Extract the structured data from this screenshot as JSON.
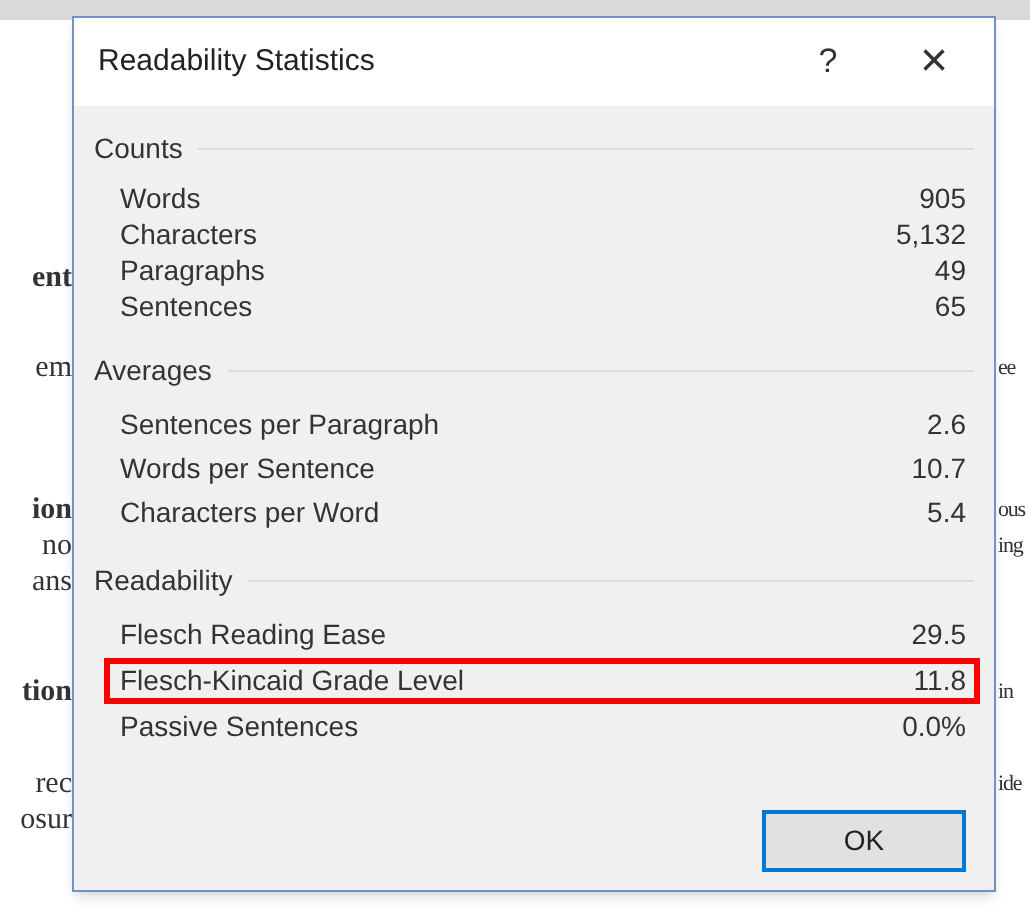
{
  "document": {
    "left_fragments": [
      {
        "text": "ent",
        "bold": true
      },
      {
        "text": "em",
        "bold": false
      },
      {
        "text": "ion",
        "bold": true
      },
      {
        "text": "no",
        "bold": false
      },
      {
        "text": "ans",
        "bold": false
      },
      {
        "text": "tion",
        "bold": true
      },
      {
        "text": "rec",
        "bold": false
      },
      {
        "text": "osur",
        "bold": false
      }
    ],
    "right_fragments": [
      {
        "text": "ee",
        "bold": false
      },
      {
        "text": "ous",
        "bold": false
      },
      {
        "text": "ing",
        "bold": false
      },
      {
        "text": "in",
        "bold": false
      },
      {
        "text": "ide",
        "bold": false
      }
    ]
  },
  "dialog": {
    "title": "Readability Statistics",
    "help": "?",
    "close": "×",
    "sections": [
      {
        "heading": "Counts",
        "rows": [
          {
            "label": "Words",
            "value": "905",
            "highlighted": false
          },
          {
            "label": "Characters",
            "value": "5,132",
            "highlighted": false
          },
          {
            "label": "Paragraphs",
            "value": "49",
            "highlighted": false
          },
          {
            "label": "Sentences",
            "value": "65",
            "highlighted": false
          }
        ]
      },
      {
        "heading": "Averages",
        "rows": [
          {
            "label": "Sentences per Paragraph",
            "value": "2.6",
            "highlighted": false
          },
          {
            "label": "Words per Sentence",
            "value": "10.7",
            "highlighted": false
          },
          {
            "label": "Characters per Word",
            "value": "5.4",
            "highlighted": false
          }
        ]
      },
      {
        "heading": "Readability",
        "rows": [
          {
            "label": "Flesch Reading Ease",
            "value": "29.5",
            "highlighted": false
          },
          {
            "label": "Flesch-Kincaid Grade Level",
            "value": "11.8",
            "highlighted": true
          },
          {
            "label": "Passive Sentences",
            "value": "0.0%",
            "highlighted": false
          }
        ]
      }
    ],
    "buttons": [
      "OK"
    ]
  }
}
